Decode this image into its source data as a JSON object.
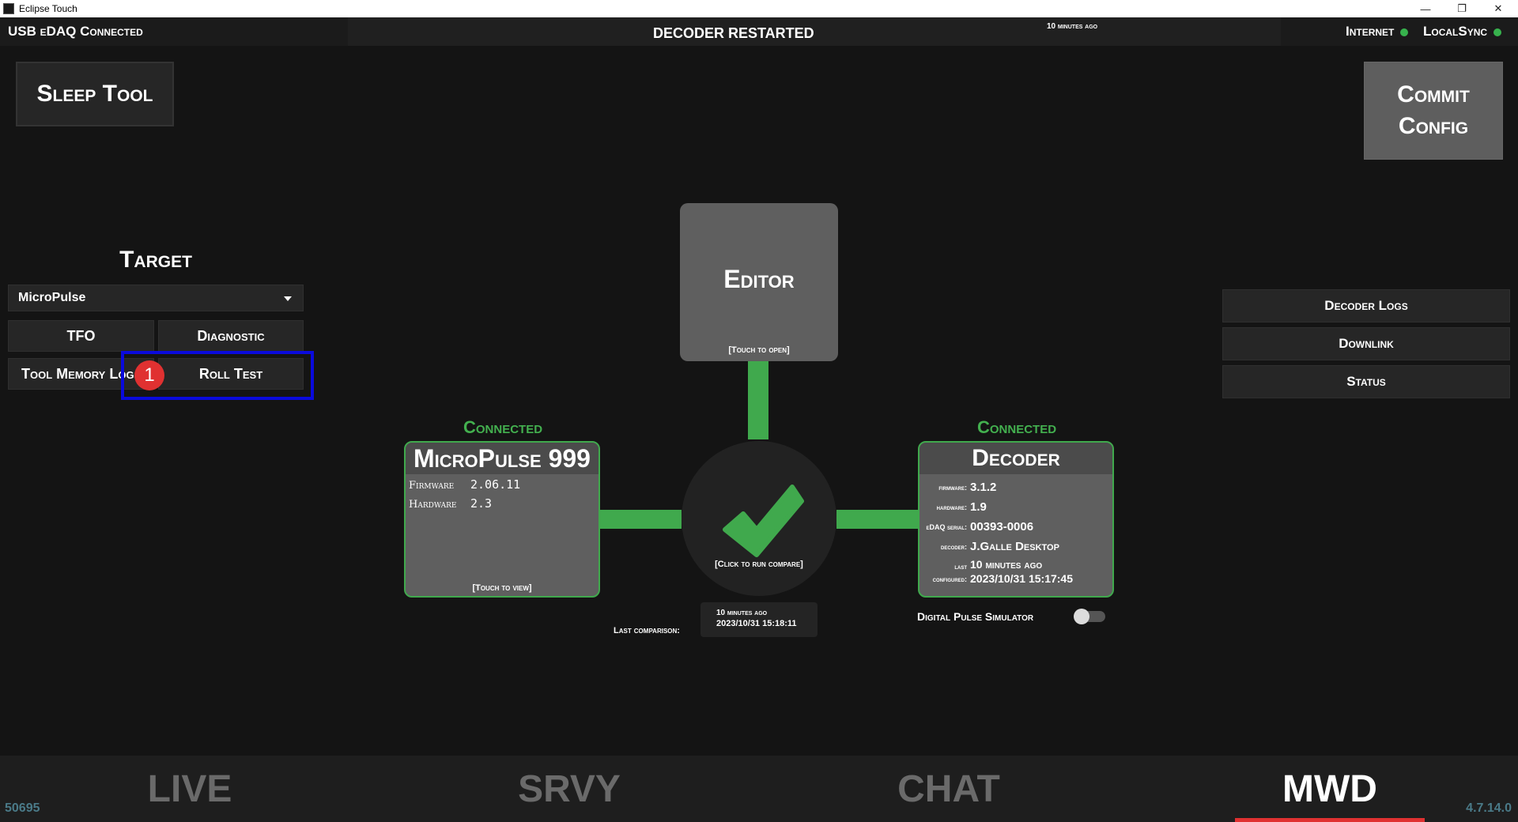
{
  "window": {
    "title": "Eclipse Touch"
  },
  "status": {
    "usb": "USB eDAQ Connected",
    "message": "DECODER RESTARTED",
    "time": "10 minutes ago",
    "internet": "Internet",
    "localsync": "LocalSync"
  },
  "buttons": {
    "sleep_tool": "Sleep Tool",
    "commit_config_line1": "Commit",
    "commit_config_line2": "Config"
  },
  "target": {
    "heading": "Target",
    "selected": "MicroPulse",
    "buttons": [
      "TFO",
      "Diagnostic",
      "Tool Memory Logs",
      "Roll Test"
    ]
  },
  "annotation": {
    "badge": "1"
  },
  "editor": {
    "title": "Editor",
    "hint": "[Touch to open]"
  },
  "micropulse": {
    "status": "Connected",
    "title": "MicroPulse 999",
    "rows": [
      {
        "label": "Firmware",
        "value": "2.06.11"
      },
      {
        "label": "Hardware",
        "value": "2.3"
      }
    ],
    "hint": "[Touch to view]"
  },
  "compare": {
    "hint": "[Click to run compare]",
    "last_label": "Last comparison:",
    "last_ago": "10 minutes ago",
    "last_date": "2023/10/31 15:18:11"
  },
  "decoder": {
    "status": "Connected",
    "title": "Decoder",
    "rows": [
      {
        "label": "firmware:",
        "value": "3.1.2"
      },
      {
        "label": "hardware:",
        "value": "1.9"
      },
      {
        "label": "eDAQ serial:",
        "value": "00393-0006"
      },
      {
        "label": "decoder:",
        "value": "J.Galle Desktop"
      }
    ],
    "last_label_1": "last",
    "last_label_2": "configured:",
    "last_ago": "10 minutes ago",
    "last_date": "2023/10/31 15:17:45"
  },
  "simulator": {
    "label": "Digital Pulse Simulator",
    "enabled": false
  },
  "right_menu": [
    "Decoder Logs",
    "Downlink",
    "Status"
  ],
  "bottom_nav": {
    "tabs": [
      "LIVE",
      "SRVY",
      "CHAT",
      "MWD"
    ],
    "active": "MWD",
    "left_code": "50695",
    "version": "4.7.14.0"
  },
  "colors": {
    "accent_green": "#40a94d",
    "highlight_blue": "#0a0adc",
    "badge_red": "#e03131"
  }
}
